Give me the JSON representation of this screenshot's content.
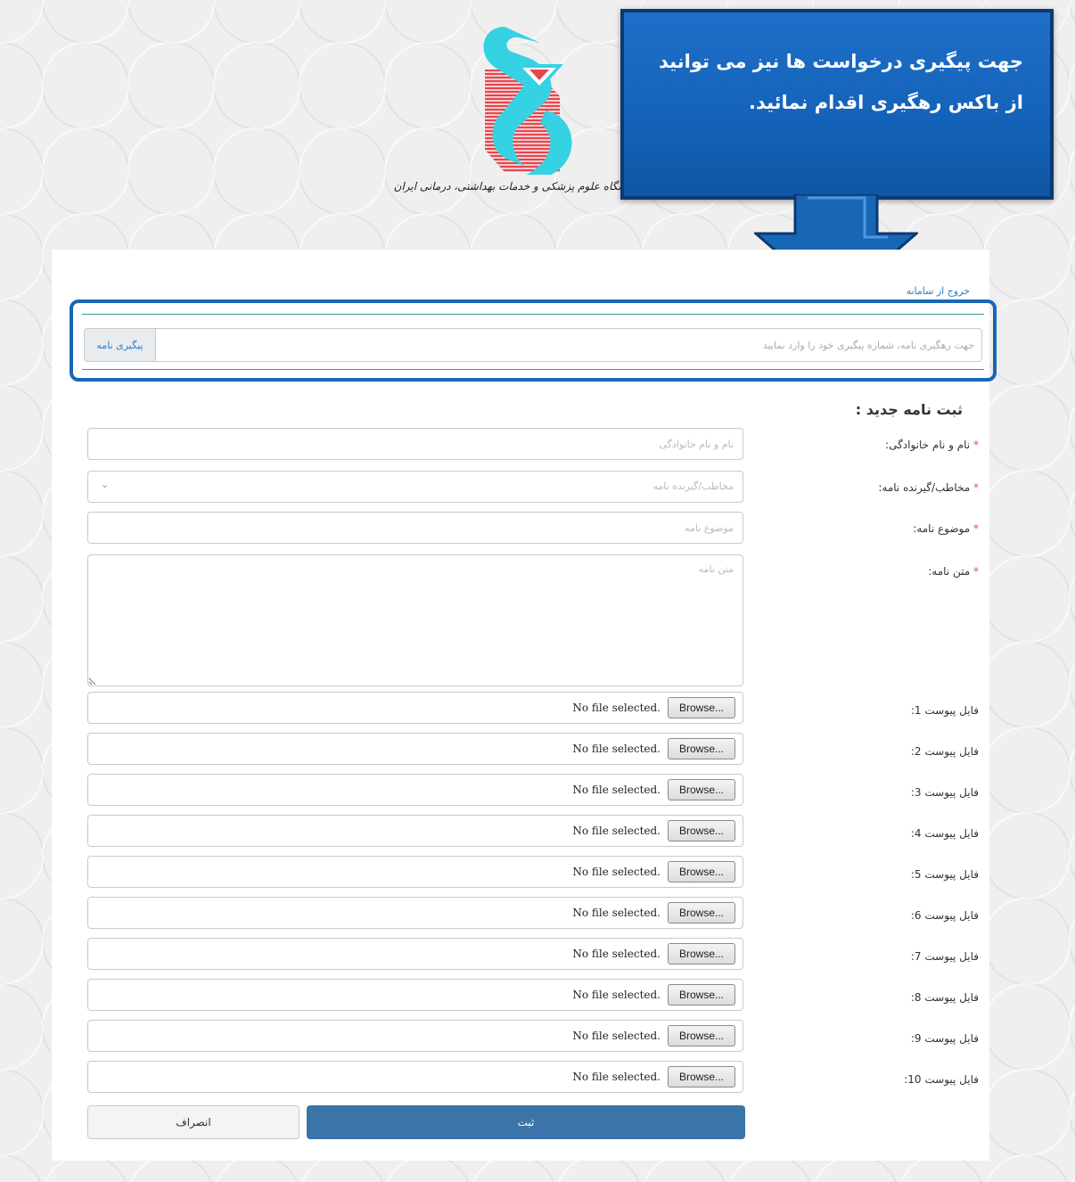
{
  "header": {
    "logo_caption": "دانشگاه علوم پزشکی و خدمات بهداشتی، درمانی ایران",
    "callout_text": "جهت پیگیری درخواست ها نیز می توانید از باکس رهگیری اقدام نمائید."
  },
  "nav": {
    "logout_label": "خروج از سامانه"
  },
  "tracking": {
    "placeholder": "جهت رهگیری نامه، شماره پیگیری خود را وارد نمایید",
    "button_label": "پیگیری نامه"
  },
  "form": {
    "title": "ثبت نامه جدید :",
    "required_marker": "*",
    "fields": {
      "name": {
        "label": "نام و نام خانوادگی:",
        "placeholder": "نام و نام خانوادگی"
      },
      "recipient": {
        "label": "مخاطب/گیرنده نامه:",
        "placeholder": "مخاطب/گیرنده نامه"
      },
      "subject": {
        "label": "موضوع نامه:",
        "placeholder": "موضوع نامه"
      },
      "body": {
        "label": "متن نامه:",
        "placeholder": "متن نامه"
      }
    },
    "attachments": [
      {
        "label": "فایل پیوست 1:",
        "button": "Browse...",
        "status": "No file selected."
      },
      {
        "label": "فایل پیوست 2:",
        "button": "Browse...",
        "status": "No file selected."
      },
      {
        "label": "فایل پیوست 3:",
        "button": "Browse...",
        "status": "No file selected."
      },
      {
        "label": "فایل پیوست 4:",
        "button": "Browse...",
        "status": "No file selected."
      },
      {
        "label": "فایل پیوست 5:",
        "button": "Browse...",
        "status": "No file selected."
      },
      {
        "label": "فایل پیوست 6:",
        "button": "Browse...",
        "status": "No file selected."
      },
      {
        "label": "فایل پیوست 7:",
        "button": "Browse...",
        "status": "No file selected."
      },
      {
        "label": "فایل پیوست 8:",
        "button": "Browse...",
        "status": "No file selected."
      },
      {
        "label": "فایل پیوست 9:",
        "button": "Browse...",
        "status": "No file selected."
      },
      {
        "label": "فایل پیوست 10:",
        "button": "Browse...",
        "status": "No file selected."
      }
    ],
    "submit_label": "ثبت",
    "cancel_label": "انصراف"
  },
  "colors": {
    "callout": "#1462b8",
    "highlight_frame": "#1767b5",
    "submit": "#3a74a8",
    "logo_cyan": "#35d2e4",
    "logo_red": "#e3474f"
  }
}
